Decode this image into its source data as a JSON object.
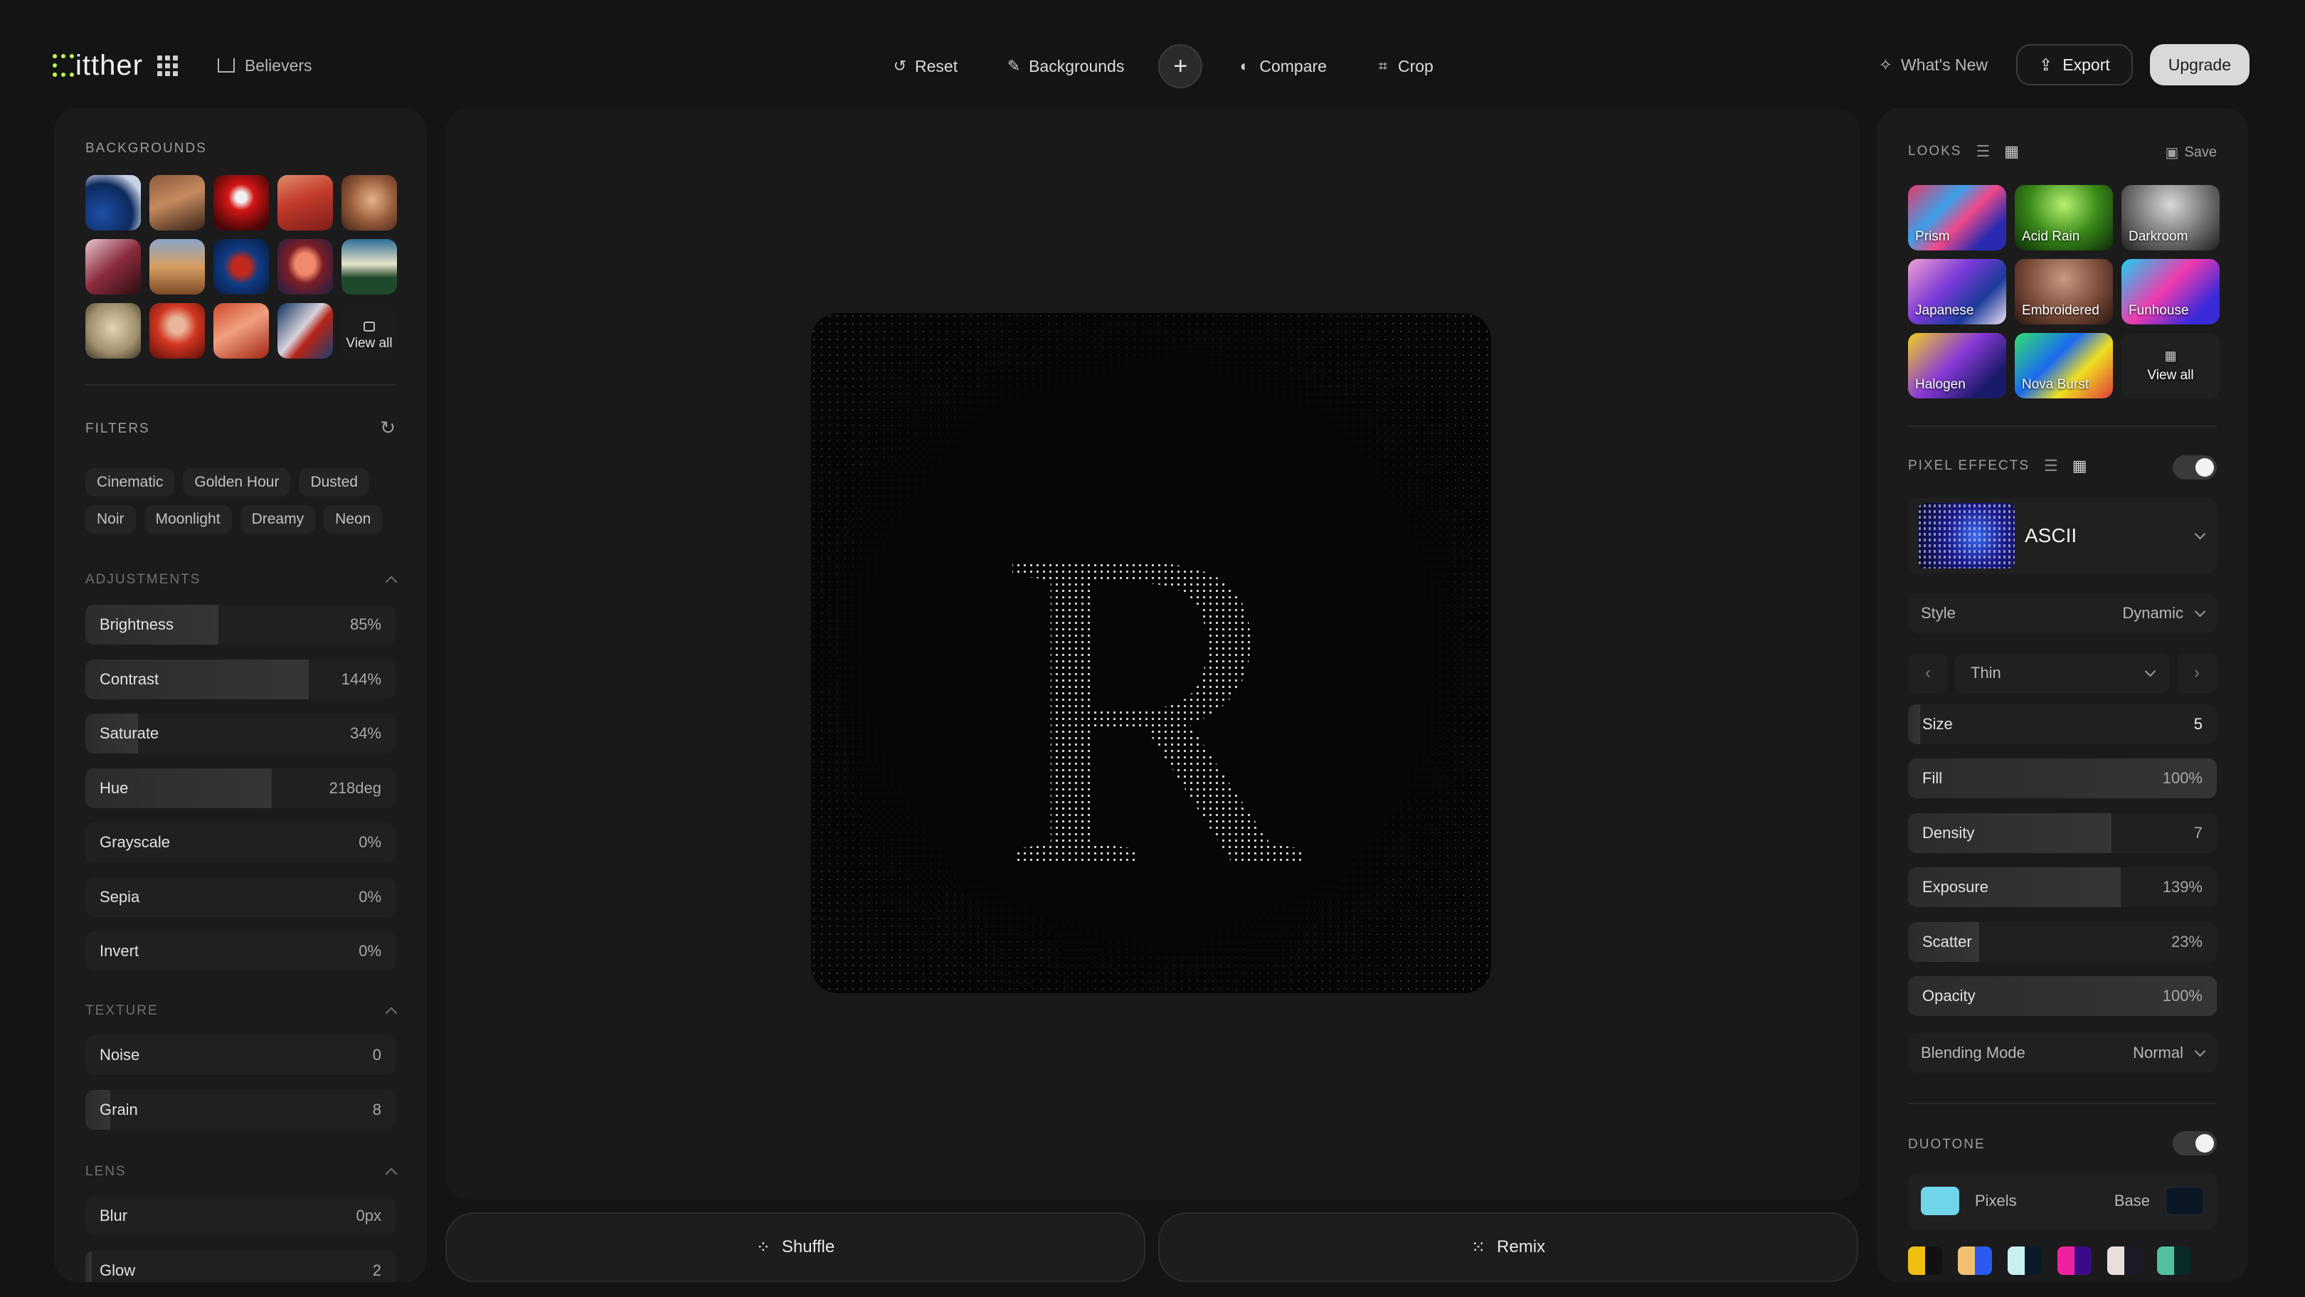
{
  "app": {
    "name": "itther",
    "workspace": "Believers"
  },
  "toolbar": {
    "reset": "Reset",
    "backgrounds": "Backgrounds",
    "compare": "Compare",
    "crop": "Crop",
    "whats_new": "What's New",
    "export": "Export",
    "upgrade": "Upgrade"
  },
  "left": {
    "backgrounds_title": "BACKGROUNDS",
    "view_all": "View all",
    "filters_title": "FILTERS",
    "filters": [
      "Cinematic",
      "Golden Hour",
      "Dusted",
      "Noir",
      "Moonlight",
      "Dreamy",
      "Neon"
    ],
    "adjustments_title": "ADJUSTMENTS",
    "adjustments": [
      {
        "label": "Brightness",
        "value": "85%",
        "level": 0.43
      },
      {
        "label": "Contrast",
        "value": "144%",
        "level": 0.72
      },
      {
        "label": "Saturate",
        "value": "34%",
        "level": 0.17
      },
      {
        "label": "Hue",
        "value": "218deg",
        "level": 0.6
      },
      {
        "label": "Grayscale",
        "value": "0%",
        "level": 0
      },
      {
        "label": "Sepia",
        "value": "0%",
        "level": 0
      },
      {
        "label": "Invert",
        "value": "0%",
        "level": 0
      }
    ],
    "texture_title": "TEXTURE",
    "texture": [
      {
        "label": "Noise",
        "value": "0",
        "level": 0
      },
      {
        "label": "Grain",
        "value": "8",
        "level": 0.08
      }
    ],
    "lens_title": "LENS",
    "lens": [
      {
        "label": "Blur",
        "value": "0px",
        "level": 0
      },
      {
        "label": "Glow",
        "value": "2",
        "level": 0.02
      }
    ]
  },
  "canvas": {
    "letter": "R"
  },
  "actions": {
    "shuffle": "Shuffle",
    "remix": "Remix"
  },
  "right": {
    "looks_title": "LOOKS",
    "save": "Save",
    "looks": [
      "Prism",
      "Acid Rain",
      "Darkroom",
      "Japanese",
      "Embroidered",
      "Funhouse",
      "Halogen",
      "Nova Burst"
    ],
    "view_all": "View all",
    "pixel_effects_title": "PIXEL EFFECTS",
    "effect_name": "ASCII",
    "style_label": "Style",
    "style_value": "Dynamic",
    "weight_value": "Thin",
    "sliders": [
      {
        "label": "Size",
        "value": "5",
        "level": 0.04
      },
      {
        "label": "Fill",
        "value": "100%",
        "level": 1.0
      },
      {
        "label": "Density",
        "value": "7",
        "level": 0.66
      },
      {
        "label": "Exposure",
        "value": "139%",
        "level": 0.69
      },
      {
        "label": "Scatter",
        "value": "23%",
        "level": 0.23
      },
      {
        "label": "Opacity",
        "value": "100%",
        "level": 1.0
      }
    ],
    "blending_label": "Blending Mode",
    "blending_value": "Normal",
    "duotone_title": "DUOTONE",
    "pixels_label": "Pixels",
    "base_label": "Base",
    "pixels_color": "#6fd6ea",
    "base_color": "#0c1726"
  }
}
